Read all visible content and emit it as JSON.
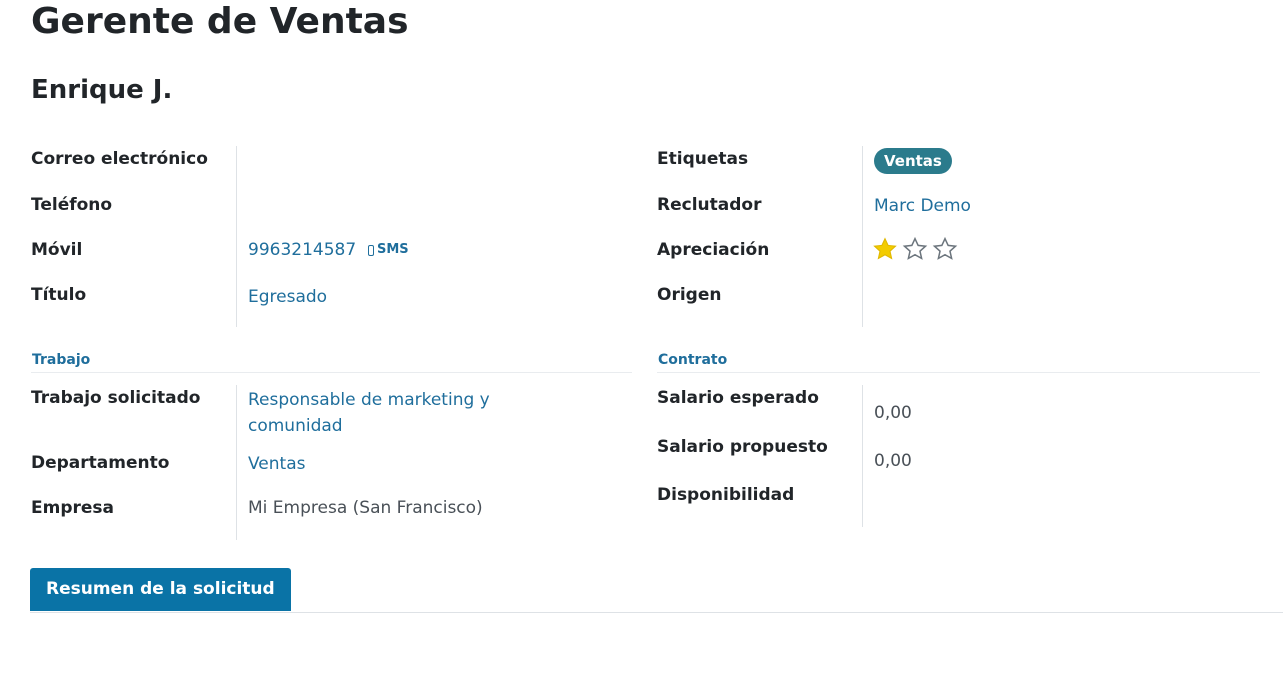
{
  "header": {
    "title": "Gerente de Ventas",
    "candidate_name": "Enrique J."
  },
  "left_fields": {
    "email": {
      "label": "Correo electrónico",
      "value": ""
    },
    "phone": {
      "label": "Teléfono",
      "value": ""
    },
    "mobile": {
      "label": "Móvil",
      "value": "9963214587",
      "sms_label": "SMS"
    },
    "degree": {
      "label": "Título",
      "value": "Egresado"
    }
  },
  "right_fields": {
    "tags": {
      "label": "Etiquetas",
      "items": [
        "Ventas"
      ]
    },
    "recruiter": {
      "label": "Reclutador",
      "value": "Marc Demo"
    },
    "evaluation": {
      "label": "Apreciación",
      "stars_filled": 1,
      "stars_total": 3
    },
    "source": {
      "label": "Origen",
      "value": ""
    }
  },
  "job_section": {
    "title": "Trabajo",
    "job_applied": {
      "label": "Trabajo solicitado",
      "value_line1": "Responsable de marketing y",
      "value_line2": "comunidad"
    },
    "department": {
      "label": "Departamento",
      "value": "Ventas"
    },
    "company": {
      "label": "Empresa",
      "value": "Mi Empresa (San Francisco)"
    }
  },
  "contract_section": {
    "title": "Contrato",
    "expected_salary": {
      "label": "Salario esperado",
      "value": "0,00"
    },
    "proposed_salary": {
      "label": "Salario propuesto",
      "value": "0,00"
    },
    "availability": {
      "label": "Disponibilidad",
      "value": ""
    }
  },
  "tabs": {
    "summary_label": "Resumen de la solicitud"
  },
  "colors": {
    "link": "#1f6e9c",
    "tag_bg": "#2b7b8c",
    "button_bg": "#0a73a6",
    "star_filled": "#f3cc00",
    "star_empty": "#6c757d"
  }
}
